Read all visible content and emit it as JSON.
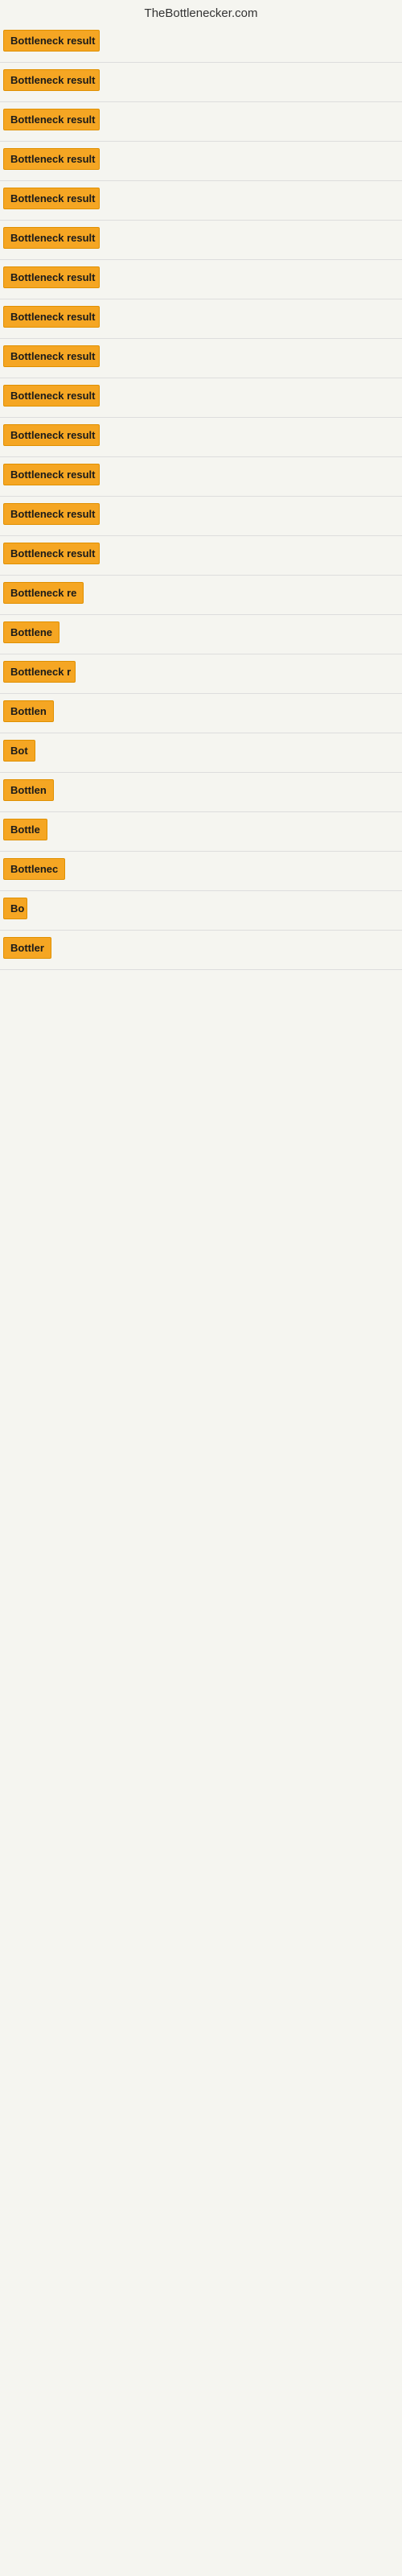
{
  "site": {
    "title": "TheBottlenecker.com"
  },
  "results": [
    {
      "label": "Bottleneck result",
      "width": 120
    },
    {
      "label": "Bottleneck result",
      "width": 120
    },
    {
      "label": "Bottleneck result",
      "width": 120
    },
    {
      "label": "Bottleneck result",
      "width": 120
    },
    {
      "label": "Bottleneck result",
      "width": 120
    },
    {
      "label": "Bottleneck result",
      "width": 120
    },
    {
      "label": "Bottleneck result",
      "width": 120
    },
    {
      "label": "Bottleneck result",
      "width": 120
    },
    {
      "label": "Bottleneck result",
      "width": 120
    },
    {
      "label": "Bottleneck result",
      "width": 120
    },
    {
      "label": "Bottleneck result",
      "width": 120
    },
    {
      "label": "Bottleneck result",
      "width": 120
    },
    {
      "label": "Bottleneck result",
      "width": 120
    },
    {
      "label": "Bottleneck result",
      "width": 120
    },
    {
      "label": "Bottleneck re",
      "width": 100
    },
    {
      "label": "Bottlene",
      "width": 80
    },
    {
      "label": "Bottleneck r",
      "width": 90
    },
    {
      "label": "Bottlen",
      "width": 72
    },
    {
      "label": "Bot",
      "width": 40
    },
    {
      "label": "Bottlen",
      "width": 72
    },
    {
      "label": "Bottle",
      "width": 60
    },
    {
      "label": "Bottlenec",
      "width": 82
    },
    {
      "label": "Bo",
      "width": 30
    },
    {
      "label": "Bottler",
      "width": 62
    }
  ]
}
